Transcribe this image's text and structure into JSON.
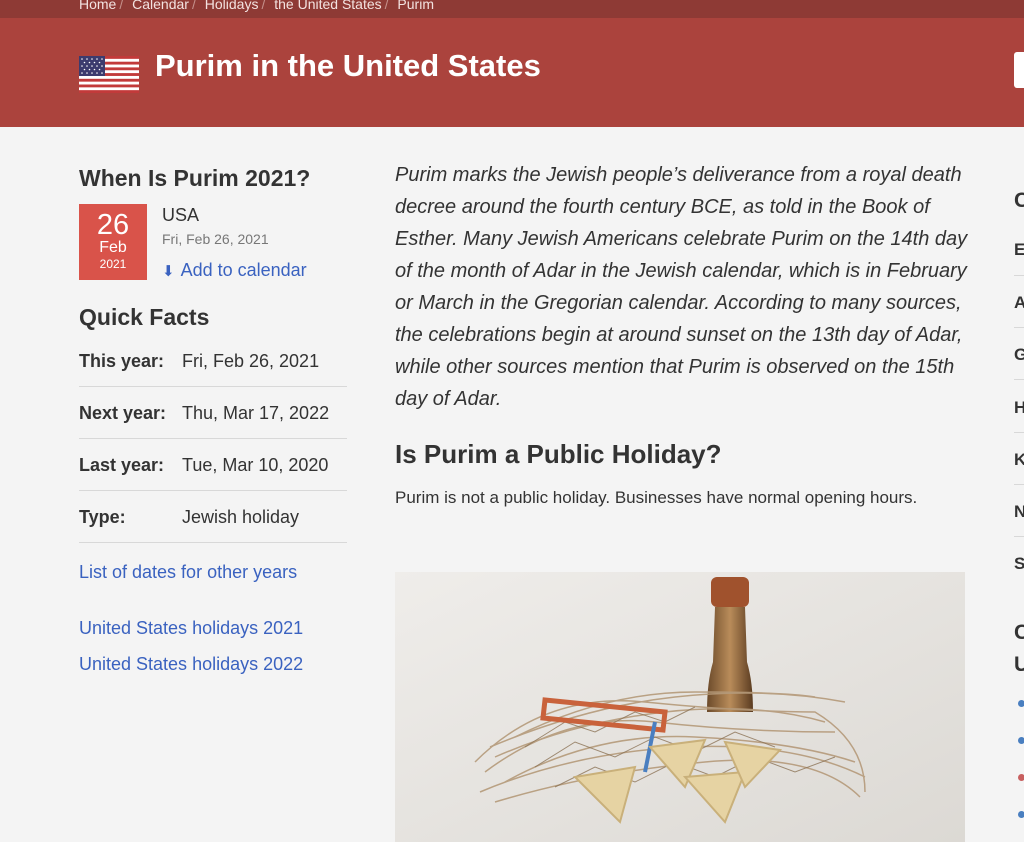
{
  "breadcrumb": [
    "Home",
    "Calendar",
    "Holidays",
    "the United States",
    "Purim"
  ],
  "header": {
    "title": "Purim in the United States"
  },
  "when": {
    "title": "When Is Purim 2021?",
    "day": "26",
    "month": "Feb",
    "year": "2021",
    "country": "USA",
    "full_date": "Fri, Feb 26, 2021",
    "add_to_calendar": "Add to calendar"
  },
  "quick_facts": {
    "title": "Quick Facts",
    "rows": [
      {
        "key": "This year:",
        "value": "Fri, Feb 26, 2021"
      },
      {
        "key": "Next year:",
        "value": "Thu, Mar 17, 2022"
      },
      {
        "key": "Last year:",
        "value": "Tue, Mar 10, 2020"
      },
      {
        "key": "Type:",
        "value": "Jewish holiday"
      }
    ]
  },
  "links": {
    "other_years": "List of dates for other years",
    "holidays_2021": "United States holidays 2021",
    "holidays_2022": "United States holidays 2022"
  },
  "main": {
    "intro": "Purim marks the Jewish people’s deliverance from a royal death decree around the fourth century BCE, as told in the Book of Esther. Many Jewish Americans celebrate Purim on the 14th day of the month of Adar in the Jewish calendar, which is in February or March in the Gregorian calendar. According to many sources, the celebrations begin at around sunset on the 13th day of Adar, while other sources mention that Purim is observed on the 15th day of Adar.",
    "public_holiday_heading": "Is Purim a Public Holiday?",
    "public_holiday_text": "Purim is not a public holiday. Businesses have normal opening hours."
  },
  "right_sidebar": {
    "items": [
      "C",
      "E",
      "A",
      "G",
      "H",
      "K",
      "N",
      "S"
    ],
    "bottom_heading": [
      "C",
      "U"
    ]
  },
  "colors": {
    "header": "#ab433d",
    "breadcrumb_bar": "#8e3a35",
    "date_box": "#d9534a",
    "link": "#3a62c0"
  }
}
